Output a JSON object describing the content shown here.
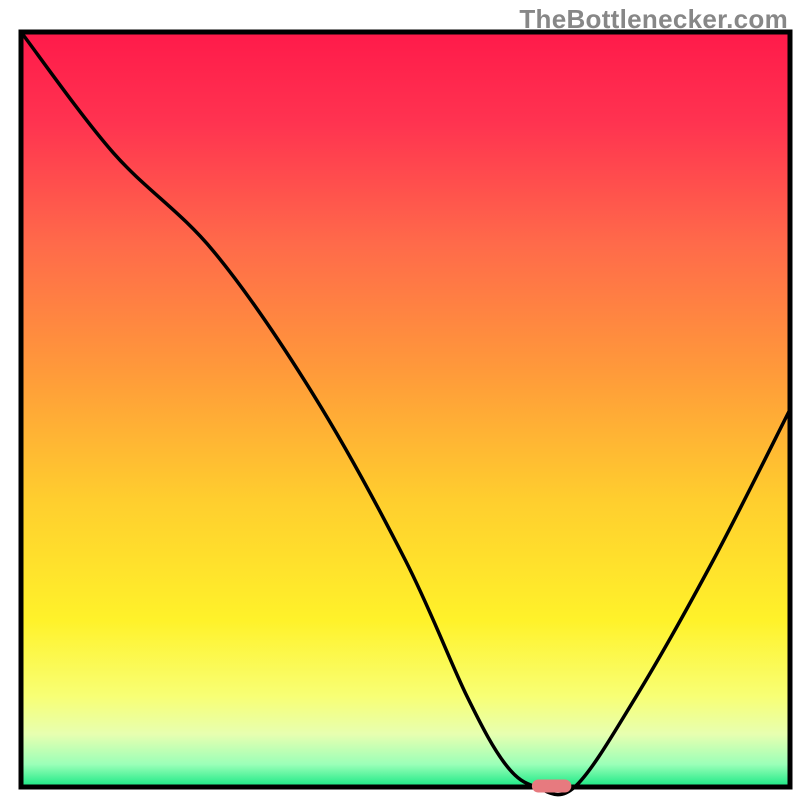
{
  "watermark_text": "TheBottlenecker.com",
  "colors": {
    "frame": "#000000",
    "curve": "#000000",
    "marker_fill": "#e77a7f",
    "marker_stroke": "#e77a7f",
    "gradient_stops": [
      {
        "offset": "0%",
        "color": "#ff1a4a"
      },
      {
        "offset": "12%",
        "color": "#ff3350"
      },
      {
        "offset": "28%",
        "color": "#ff6a4a"
      },
      {
        "offset": "45%",
        "color": "#ff9a3a"
      },
      {
        "offset": "62%",
        "color": "#ffce2e"
      },
      {
        "offset": "78%",
        "color": "#fff22a"
      },
      {
        "offset": "88%",
        "color": "#f8ff75"
      },
      {
        "offset": "93%",
        "color": "#e7ffb0"
      },
      {
        "offset": "97%",
        "color": "#9bffb8"
      },
      {
        "offset": "100%",
        "color": "#17e884"
      }
    ]
  },
  "chart_data": {
    "type": "line",
    "title": "",
    "xlabel": "",
    "ylabel": "",
    "xlim": [
      0,
      100
    ],
    "ylim": [
      0,
      100
    ],
    "x": [
      0,
      12,
      25,
      38,
      50,
      58,
      63,
      67,
      72,
      80,
      90,
      100
    ],
    "values": [
      100,
      84,
      71,
      52,
      30,
      12,
      3,
      0,
      0,
      12,
      30,
      50
    ],
    "marker": {
      "x": 69,
      "y": 0,
      "width": 5,
      "height": 1.6
    },
    "note": "y is bottleneck-percentage; 0 = green baseline, 100 = top (red). Values are visual estimates from the plot."
  }
}
